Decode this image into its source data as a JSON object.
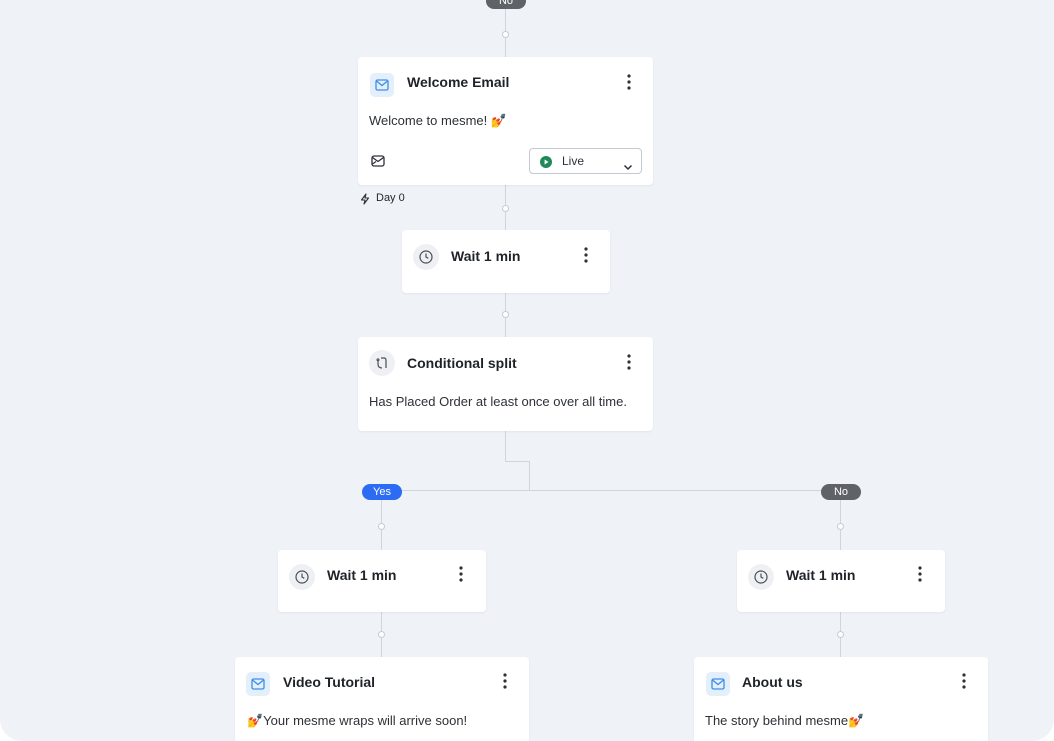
{
  "flow": {
    "top_branch_label": "No",
    "welcome_email": {
      "title": "Welcome Email",
      "subject": "Welcome to mesme! 💅",
      "status": "Live",
      "trigger_day": "Day 0"
    },
    "wait_1": {
      "title": "Wait 1 min"
    },
    "conditional_split": {
      "title": "Conditional split",
      "condition": "Has Placed Order at least once over all time."
    },
    "branches": {
      "yes_label": "Yes",
      "no_label": "No"
    },
    "yes_wait": {
      "title": "Wait 1 min"
    },
    "no_wait": {
      "title": "Wait 1 min"
    },
    "video_tutorial": {
      "title": "Video Tutorial",
      "subject": "💅Your mesme wraps will arrive soon!"
    },
    "about_us": {
      "title": "About us",
      "subject": "The story behind mesme💅"
    }
  },
  "colors": {
    "canvas": "#eff2f6",
    "yes_pill": "#2b6cf2",
    "no_pill": "#5f6368",
    "live_status": "#1e8a5a",
    "email_icon": "#3d8ee8"
  }
}
